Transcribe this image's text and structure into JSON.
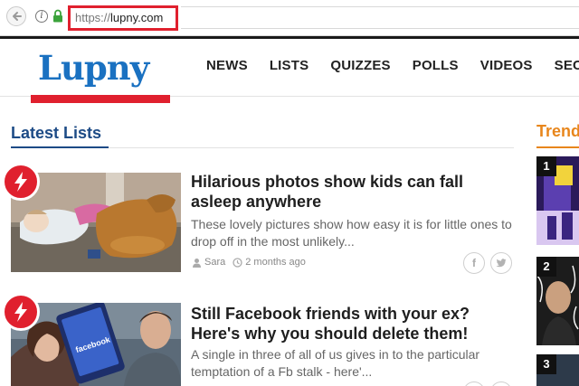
{
  "browser": {
    "url_scheme": "https://",
    "url_host": "lupny.com"
  },
  "site": {
    "logo": "Lupny",
    "nav": [
      "NEWS",
      "LISTS",
      "QUIZZES",
      "POLLS",
      "VIDEOS",
      "SECT"
    ]
  },
  "section": {
    "title": "Latest Lists"
  },
  "articles": [
    {
      "title": "Hilarious photos show kids can fall asleep anywhere",
      "excerpt": "These lovely pictures show how easy it is for little ones to drop off in the most unlikely...",
      "author": "Sara",
      "time": "2 months ago"
    },
    {
      "title": "Still Facebook friends with your ex? Here's why you should delete them!",
      "excerpt": "A single in three of all of us gives in to the particular temptation of a Fb stalk - here'...",
      "thumb_label": "facebook"
    }
  ],
  "trending": {
    "title": "Trend",
    "items": [
      "1",
      "2",
      "3"
    ]
  },
  "colors": {
    "brand_blue": "#1a71c1",
    "accent_red": "#e0202e",
    "trending_orange": "#e8861c",
    "section_blue": "#1d4b86"
  }
}
